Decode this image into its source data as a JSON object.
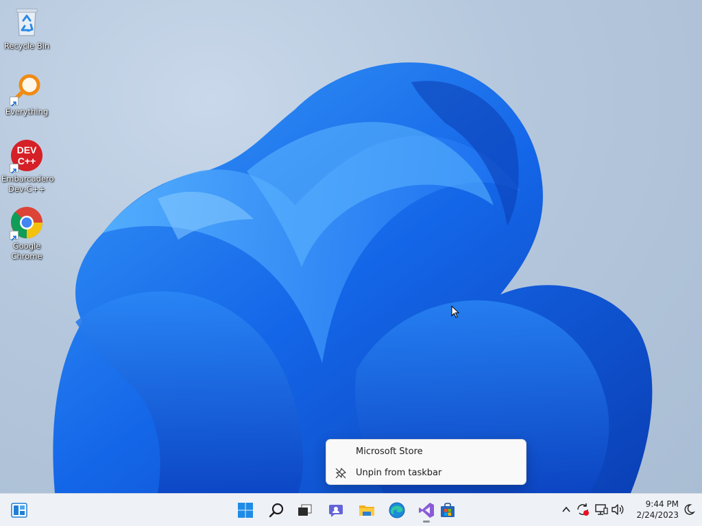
{
  "desktop": {
    "icons": [
      {
        "label": "Recycle Bin",
        "icon": "recycle-bin-icon"
      },
      {
        "label": "Everything",
        "icon": "everything-search-icon"
      },
      {
        "label": "Embarcadero Dev-C++",
        "icon": "dev-cpp-icon"
      },
      {
        "label": "Google Chrome",
        "icon": "chrome-icon"
      }
    ],
    "dev_icon_text_top": "DEV",
    "dev_icon_text_bottom": "C++"
  },
  "context_menu": {
    "items": [
      {
        "label": "Microsoft Store",
        "icon": ""
      },
      {
        "label": "Unpin from taskbar",
        "icon": "unpin-icon"
      }
    ]
  },
  "taskbar": {
    "widgets": "widgets-icon",
    "pinned": [
      {
        "icon": "start-icon"
      },
      {
        "icon": "search-icon"
      },
      {
        "icon": "task-view-icon"
      },
      {
        "icon": "chat-icon"
      },
      {
        "icon": "file-explorer-icon"
      },
      {
        "icon": "edge-icon"
      },
      {
        "icon": "visual-studio-icon"
      },
      {
        "icon": "microsoft-store-icon"
      }
    ],
    "tray": [
      "chevron-up-icon",
      "sync-icon",
      "network-icon",
      "volume-icon"
    ],
    "clock": {
      "time": "9:44 PM",
      "date": "2/24/2023"
    }
  },
  "colors": {
    "accent": "#0067c0",
    "wallpaper_blue": "#1565e6",
    "taskbar_bg": "#eef1f6"
  }
}
